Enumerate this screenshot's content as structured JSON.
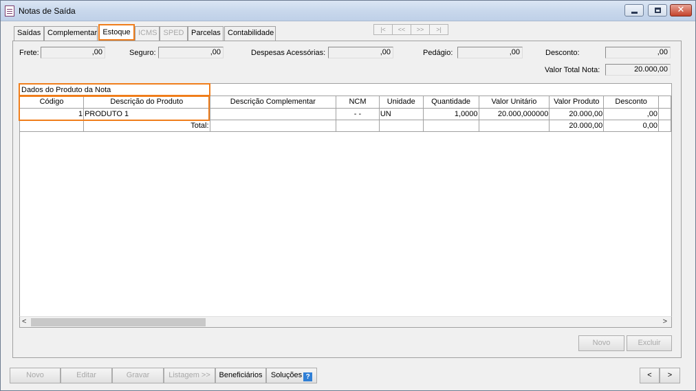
{
  "window": {
    "title": "Notas de Saída"
  },
  "tabs": [
    {
      "label": "Saídas",
      "state": "normal"
    },
    {
      "label": "Complementar",
      "state": "normal"
    },
    {
      "label": "Estoque",
      "state": "active"
    },
    {
      "label": "ICMS",
      "state": "disabled"
    },
    {
      "label": "SPED",
      "state": "disabled"
    },
    {
      "label": "Parcelas",
      "state": "normal"
    },
    {
      "label": "Contabilidade",
      "state": "normal"
    }
  ],
  "record_nav": {
    "first": "|<",
    "prev": "<<",
    "next": ">>",
    "last": ">|"
  },
  "totals": {
    "frete_label": "Frete:",
    "frete_value": ",00",
    "seguro_label": "Seguro:",
    "seguro_value": ",00",
    "despesas_label": "Despesas Acessórias:",
    "despesas_value": ",00",
    "pedagio_label": "Pedágio:",
    "pedagio_value": ",00",
    "desconto_label": "Desconto:",
    "desconto_value": ",00",
    "valor_total_label": "Valor Total Nota:",
    "valor_total_value": "20.000,00"
  },
  "grid": {
    "caption": "Dados do Produto da Nota",
    "columns": [
      "Código",
      "Descrição do Produto",
      "Descrição Complementar",
      "NCM",
      "Unidade",
      "Quantidade",
      "Valor Unitário",
      "Valor Produto",
      "Desconto"
    ],
    "rows": [
      [
        "1",
        "PRODUTO 1",
        "",
        "- -",
        "UN",
        "1,0000",
        "20.000,000000",
        "20.000,00",
        ",00"
      ]
    ],
    "total_row": {
      "label": "Total:",
      "valor_produto": "20.000,00",
      "desconto": "0,00"
    }
  },
  "grid_buttons": {
    "novo": "Novo",
    "excluir": "Excluir"
  },
  "footer": {
    "novo": "Novo",
    "editar": "Editar",
    "gravar": "Gravar",
    "listagem": "Listagem >>",
    "beneficiarios": "Beneficiários",
    "solucoes": "Soluções",
    "help": "?",
    "prev": "<",
    "next": ">"
  },
  "colors": {
    "highlight": "#f07d1a",
    "help_icon": "#2f7fd6"
  }
}
